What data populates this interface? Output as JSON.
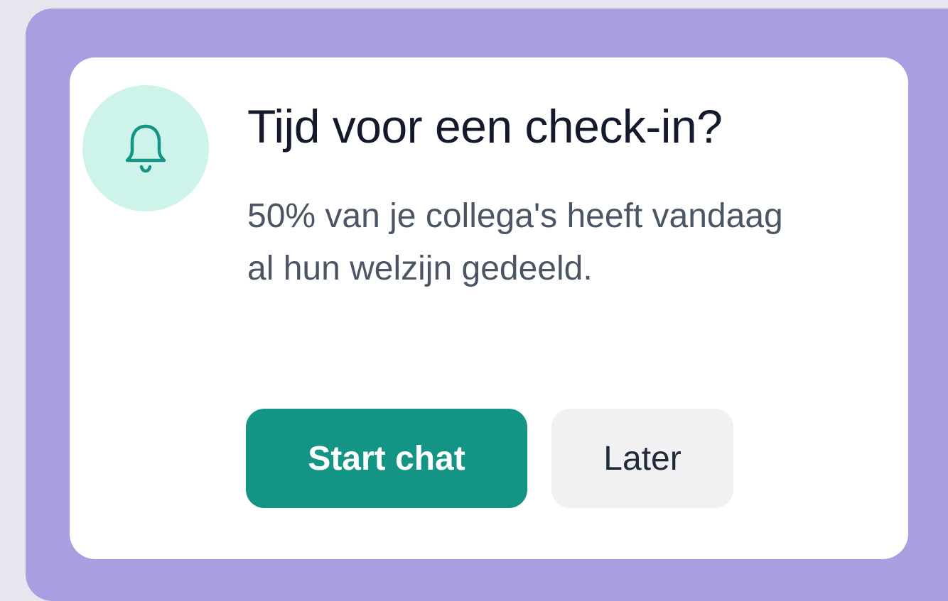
{
  "notification": {
    "icon": "bell-icon",
    "title": "Tijd voor een check-in?",
    "message": "50% van je collega's heeft vandaag al hun welzijn gedeeld.",
    "primary_action": "Start chat",
    "secondary_action": "Later"
  },
  "colors": {
    "frame": "#a99ee0",
    "card": "#ffffff",
    "icon_bg": "#cdf3ea",
    "icon_stroke": "#149484",
    "primary_button": "#149484",
    "secondary_button": "#f1f1f4",
    "title_text": "#141a2b",
    "body_text": "#4b5563"
  }
}
